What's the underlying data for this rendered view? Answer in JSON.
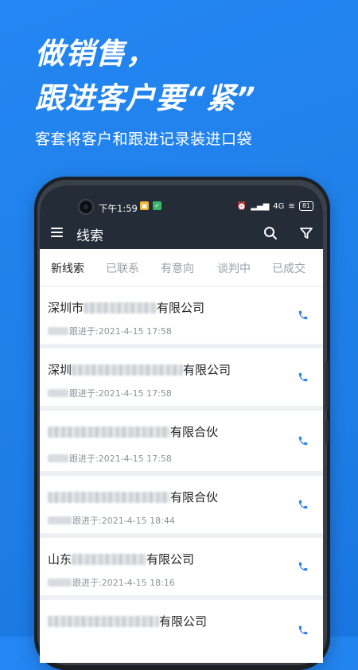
{
  "promo": {
    "headline_line1": "做销售，",
    "headline_line2": "跟进客户要“紧”",
    "subline": "客套将客户和跟进记录装进口袋"
  },
  "statusbar": {
    "time": "下午1:59",
    "network": "4G",
    "battery": "81"
  },
  "appbar": {
    "title": "线索",
    "menu_icon": "menu-icon",
    "search_icon": "search-icon",
    "filter_icon": "filter-icon"
  },
  "tabs": [
    {
      "label": "新线索",
      "active": true
    },
    {
      "label": "已联系",
      "active": false
    },
    {
      "label": "有意向",
      "active": false
    },
    {
      "label": "谈判中",
      "active": false
    },
    {
      "label": "已成交",
      "active": false
    }
  ],
  "leads": [
    {
      "company_prefix": "深圳市",
      "company_suffix": "有限公司",
      "follow_label": "跟进于: ",
      "follow_time": "2021-4-15 17:58"
    },
    {
      "company_prefix": "深圳",
      "company_suffix": "有限公司",
      "follow_label": "跟进于: ",
      "follow_time": "2021-4-15 17:58"
    },
    {
      "company_prefix": "",
      "company_suffix": "有限合伙",
      "follow_label": "跟进于: ",
      "follow_time": "2021-4-15 17:58"
    },
    {
      "company_prefix": "",
      "company_suffix": "有限合伙",
      "follow_label": "跟进于: ",
      "follow_time": "2021-4-15 18:44"
    },
    {
      "company_prefix": "山东",
      "company_suffix": "有限公司",
      "follow_label": "跟进于: ",
      "follow_time": "2021-4-15 18:16"
    },
    {
      "company_prefix": "",
      "company_suffix": "有限公司",
      "follow_label": "",
      "follow_time": ""
    }
  ],
  "colors": {
    "background": "#1f7fe9",
    "appbar": "#232c37",
    "phone_icon": "#2f7fe6"
  }
}
